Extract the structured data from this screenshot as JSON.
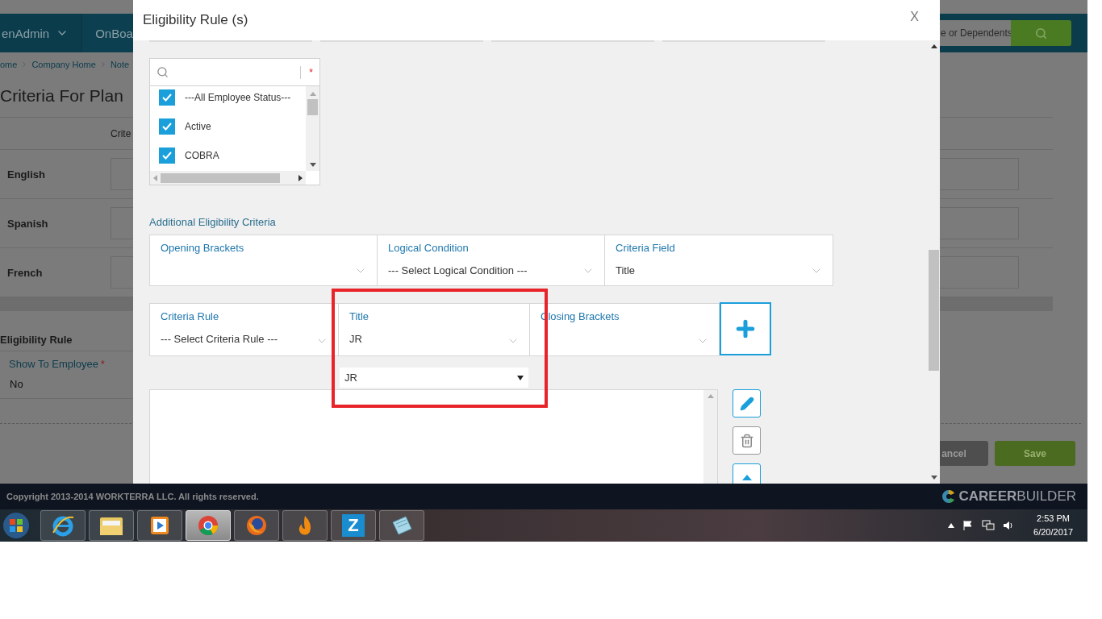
{
  "page": {
    "nav": [
      {
        "label": "enAdmin",
        "dropdown": true
      },
      {
        "label": "OnBoa"
      }
    ],
    "search": {
      "placeholder": "e or Dependents"
    },
    "breadcrumb": [
      "ome",
      "Company Home",
      "Note"
    ],
    "title": "Criteria For Plan",
    "table": {
      "column": "Crite",
      "rows": [
        "English",
        "Spanish",
        "French"
      ]
    },
    "eligibility": {
      "heading": "Eligibility Rule",
      "label": "Show To Employee",
      "required_mark": "*",
      "value": "No"
    },
    "buttons": [
      {
        "label": "ancel",
        "kind": "secondary"
      },
      {
        "label": "Save",
        "kind": "primary"
      }
    ],
    "footer": {
      "copyright": "Copyright 2013-2014 WORKTERRA LLC. All rights reserved.",
      "brand": "CAREER",
      "brand_light": "BUILDER"
    }
  },
  "modal": {
    "title": "Eligibility Rule (s)",
    "close": "X",
    "highlight": true,
    "status_filter": {
      "required_mark": "*",
      "options": [
        {
          "label": "---All Employee Status---",
          "checked": true
        },
        {
          "label": "Active",
          "checked": true
        },
        {
          "label": "COBRA",
          "checked": true
        }
      ]
    },
    "criteria_heading": "Additional Eligibility Criteria",
    "criteria_rows": [
      [
        {
          "label": "Opening Brackets"
        },
        {
          "label": "Logical Condition",
          "value": "--- Select Logical Condition ---"
        },
        {
          "label": "Criteria Field",
          "value": "Title"
        }
      ],
      [
        {
          "label": "Criteria Rule",
          "value": "--- Select Criteria Rule ---"
        },
        {
          "label": "Title",
          "value": "JR"
        },
        {
          "label": "Closing Brackets"
        }
      ]
    ],
    "value_dropdown": {
      "value": "JR"
    }
  },
  "taskbar": {
    "apps": [
      {
        "kind": "ie",
        "selected": false
      },
      {
        "kind": "folder",
        "selected": false
      },
      {
        "kind": "media",
        "selected": false
      },
      {
        "kind": "chrome",
        "selected": true
      },
      {
        "kind": "firefox",
        "selected": false
      },
      {
        "kind": "flame",
        "selected": false
      },
      {
        "kind": "z",
        "label": "Z",
        "selected": false
      },
      {
        "kind": "notepad",
        "selected": false
      }
    ],
    "time": "2:53 PM",
    "date": "6/20/2017"
  }
}
